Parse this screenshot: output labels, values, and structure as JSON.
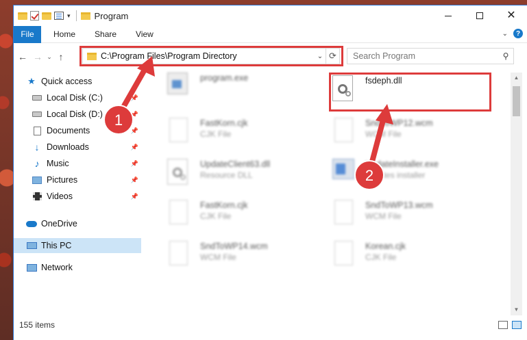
{
  "window": {
    "title": "Program",
    "controls": {
      "minimize": "minimize-icon",
      "maximize": "maximize-icon",
      "close": "✕"
    }
  },
  "ribbon": {
    "tabs": [
      "File",
      "Home",
      "Share",
      "View"
    ],
    "help": "?"
  },
  "address": {
    "path": "C:\\Program Files\\Program Directory"
  },
  "search": {
    "placeholder": "Search Program"
  },
  "sidebar": {
    "items": [
      {
        "label": "Quick access",
        "icon": "star-icon"
      },
      {
        "label": "Local Disk (C:)",
        "icon": "disk-icon",
        "pinned": true
      },
      {
        "label": "Local Disk (D:)",
        "icon": "disk-icon",
        "pinned": true
      },
      {
        "label": "Documents",
        "icon": "documents-icon",
        "pinned": true
      },
      {
        "label": "Downloads",
        "icon": "download-icon",
        "pinned": true
      },
      {
        "label": "Music",
        "icon": "music-icon",
        "pinned": true
      },
      {
        "label": "Pictures",
        "icon": "pictures-icon",
        "pinned": true
      },
      {
        "label": "Videos",
        "icon": "videos-icon",
        "pinned": true
      },
      {
        "label": "OneDrive",
        "icon": "cloud-icon"
      },
      {
        "label": "This PC",
        "icon": "computer-icon",
        "selected": true
      },
      {
        "label": "Network",
        "icon": "network-icon"
      }
    ]
  },
  "files": [
    {
      "name": "program.exe",
      "type": "",
      "icon": "exe-icon",
      "blurred": true
    },
    {
      "name": "fsdeph.dll",
      "type": "",
      "icon": "dll-icon",
      "blurred": false
    },
    {
      "name": "FastKorn.cjk",
      "type": "CJK File",
      "icon": "file-icon",
      "blurred": true
    },
    {
      "name": "SndToWP12.wcm",
      "type": "WCM File",
      "icon": "file-icon",
      "blurred": true
    },
    {
      "name": "UpdateClient63.dll",
      "type": "Resource DLL",
      "icon": "dll-icon",
      "blurred": true
    },
    {
      "name": "UpdateInstaller.exe",
      "type": "updates installer",
      "icon": "installer-icon",
      "blurred": true
    },
    {
      "name": "FastKorn.cjk",
      "type": "CJK File",
      "icon": "file-icon",
      "blurred": true
    },
    {
      "name": "SndToWP13.wcm",
      "type": "WCM File",
      "icon": "file-icon",
      "blurred": true
    },
    {
      "name": "SndToWP14.wcm",
      "type": "WCM File",
      "icon": "file-icon",
      "blurred": true
    },
    {
      "name": "Korean.cjk",
      "type": "CJK File",
      "icon": "file-icon",
      "blurred": true
    }
  ],
  "annotations": {
    "step1": "1",
    "step2": "2",
    "color": "#dd3b3b"
  },
  "status": {
    "count": "155 items"
  },
  "colors": {
    "accent": "#1979ca",
    "highlight": "#dd3b3b",
    "selected": "#cce4f7"
  }
}
